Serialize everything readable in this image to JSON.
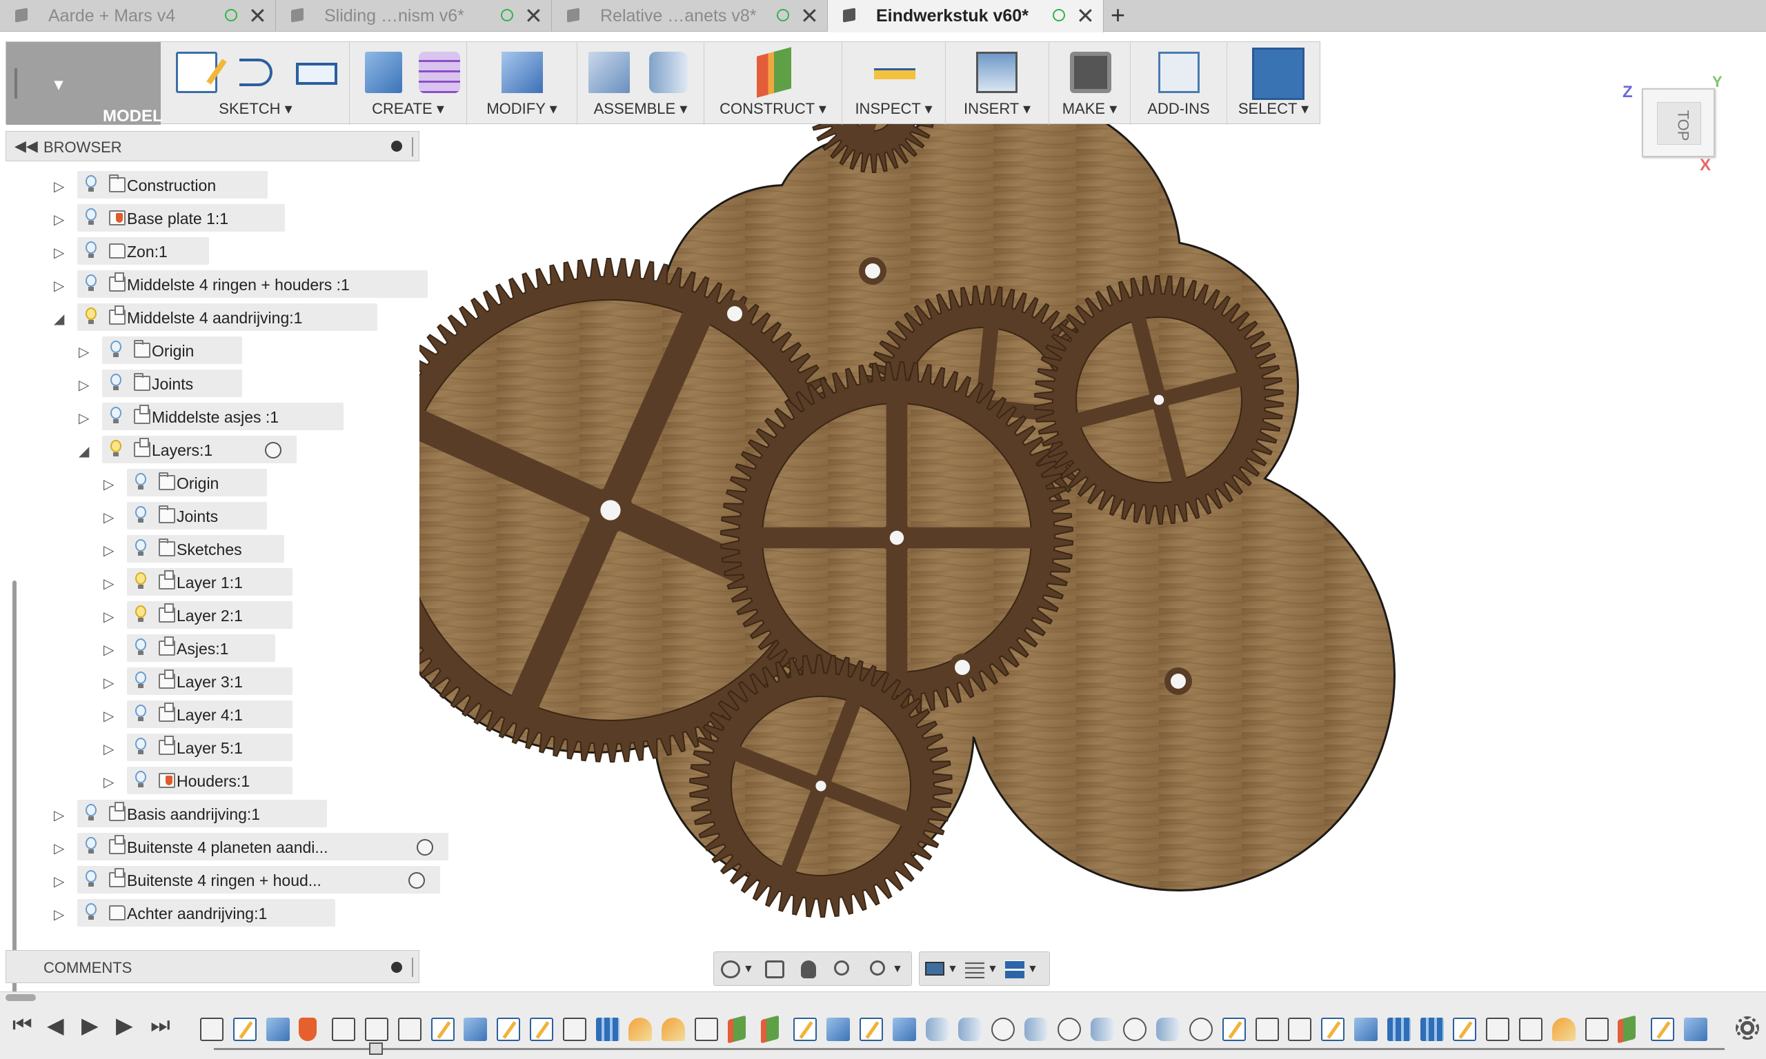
{
  "tabs": [
    {
      "label": "Aarde + Mars v4",
      "active": false
    },
    {
      "label": "Sliding …nism v6*",
      "active": false
    },
    {
      "label": "Relative …anets v8*",
      "active": false
    },
    {
      "label": "Eindwerkstuk v60*",
      "active": true
    }
  ],
  "toolbar": {
    "workspace": "MODEL",
    "groups": [
      {
        "label": "SKETCH",
        "dropdown": true
      },
      {
        "label": "CREATE",
        "dropdown": true
      },
      {
        "label": "MODIFY",
        "dropdown": true
      },
      {
        "label": "ASSEMBLE",
        "dropdown": true
      },
      {
        "label": "CONSTRUCT",
        "dropdown": true
      },
      {
        "label": "INSPECT",
        "dropdown": true
      },
      {
        "label": "INSERT",
        "dropdown": true
      },
      {
        "label": "MAKE",
        "dropdown": true
      },
      {
        "label": "ADD-INS",
        "dropdown": false
      },
      {
        "label": "SELECT",
        "dropdown": true
      }
    ]
  },
  "browser": {
    "title": "BROWSER",
    "items": [
      {
        "label": "Construction",
        "level": 0,
        "icon": "folder-icon",
        "expanded": false,
        "bulb_on": false,
        "radio": false
      },
      {
        "label": "Base plate 1:1",
        "level": 0,
        "icon": "pinned-component-icon",
        "expanded": false,
        "bulb_on": false,
        "radio": false
      },
      {
        "label": "Zon:1",
        "level": 0,
        "icon": "body-icon",
        "expanded": false,
        "bulb_on": false,
        "radio": false
      },
      {
        "label": "Middelste 4 ringen + houders :1",
        "level": 0,
        "icon": "component-icon",
        "expanded": false,
        "bulb_on": false,
        "radio": false
      },
      {
        "label": "Middelste 4 aandrijving:1",
        "level": 0,
        "icon": "component-icon",
        "expanded": true,
        "bulb_on": true,
        "radio": false
      },
      {
        "label": "Origin",
        "level": 1,
        "icon": "folder-icon",
        "expanded": false,
        "bulb_on": false,
        "radio": false
      },
      {
        "label": "Joints",
        "level": 1,
        "icon": "folder-icon",
        "expanded": false,
        "bulb_on": false,
        "radio": false
      },
      {
        "label": "Middelste asjes :1",
        "level": 1,
        "icon": "component-icon",
        "expanded": false,
        "bulb_on": false,
        "radio": false
      },
      {
        "label": "Layers:1",
        "level": 1,
        "icon": "component-icon",
        "expanded": true,
        "bulb_on": true,
        "radio": true
      },
      {
        "label": "Origin",
        "level": 2,
        "icon": "folder-icon",
        "expanded": false,
        "bulb_on": false,
        "radio": false
      },
      {
        "label": "Joints",
        "level": 2,
        "icon": "folder-icon",
        "expanded": false,
        "bulb_on": false,
        "radio": false
      },
      {
        "label": "Sketches",
        "level": 2,
        "icon": "folder-icon",
        "expanded": false,
        "bulb_on": false,
        "radio": false
      },
      {
        "label": "Layer 1:1",
        "level": 2,
        "icon": "component-icon",
        "expanded": false,
        "bulb_on": true,
        "radio": false
      },
      {
        "label": "Layer 2:1",
        "level": 2,
        "icon": "component-icon",
        "expanded": false,
        "bulb_on": true,
        "radio": false
      },
      {
        "label": "Asjes:1",
        "level": 2,
        "icon": "component-icon",
        "expanded": false,
        "bulb_on": false,
        "radio": false
      },
      {
        "label": "Layer 3:1",
        "level": 2,
        "icon": "component-icon",
        "expanded": false,
        "bulb_on": false,
        "radio": false
      },
      {
        "label": "Layer 4:1",
        "level": 2,
        "icon": "component-icon",
        "expanded": false,
        "bulb_on": false,
        "radio": false
      },
      {
        "label": "Layer 5:1",
        "level": 2,
        "icon": "component-icon",
        "expanded": false,
        "bulb_on": false,
        "radio": false
      },
      {
        "label": "Houders:1",
        "level": 2,
        "icon": "pinned-component-icon",
        "expanded": false,
        "bulb_on": false,
        "radio": false
      },
      {
        "label": "Basis aandrijving:1",
        "level": 0,
        "icon": "component-icon",
        "expanded": false,
        "bulb_on": false,
        "radio": false
      },
      {
        "label": "Buitenste 4 planeten aandi...",
        "level": 0,
        "icon": "component-icon",
        "expanded": false,
        "bulb_on": false,
        "radio": true
      },
      {
        "label": "Buitenste 4 ringen + houd...",
        "level": 0,
        "icon": "component-icon",
        "expanded": false,
        "bulb_on": false,
        "radio": true
      },
      {
        "label": "Achter aandrijving:1",
        "level": 0,
        "icon": "body-icon",
        "expanded": false,
        "bulb_on": false,
        "radio": false
      }
    ]
  },
  "comments": {
    "title": "COMMENTS"
  },
  "viewcube": {
    "face": "TOP",
    "axis_z": "Z",
    "axis_y": "Y",
    "axis_x": "X"
  },
  "colors": {
    "wood_light": "#9a7a52",
    "wood_dark": "#5a3d26",
    "accent_blue": "#3a73b4",
    "tab_dot_green": "#34b34a"
  },
  "timeline": {
    "controls": [
      "skip-to-start-icon",
      "step-back-icon",
      "play-icon",
      "step-forward-icon",
      "skip-to-end-icon"
    ],
    "features": [
      "box",
      "sketch",
      "extrude",
      "pin",
      "box",
      "box",
      "box",
      "sketch",
      "extrude",
      "sketch",
      "sketch",
      "box",
      "pattern",
      "orange",
      "orange",
      "box",
      "plane",
      "plane",
      "sketch",
      "extrude",
      "sketch",
      "extrude",
      "joint",
      "joint",
      "move",
      "joint",
      "move",
      "joint",
      "move",
      "joint",
      "move",
      "sketch",
      "box",
      "box",
      "sketch",
      "extrude",
      "pattern",
      "pattern",
      "sketch",
      "box",
      "box",
      "orange",
      "box",
      "plane",
      "sketch",
      "extrude"
    ]
  }
}
